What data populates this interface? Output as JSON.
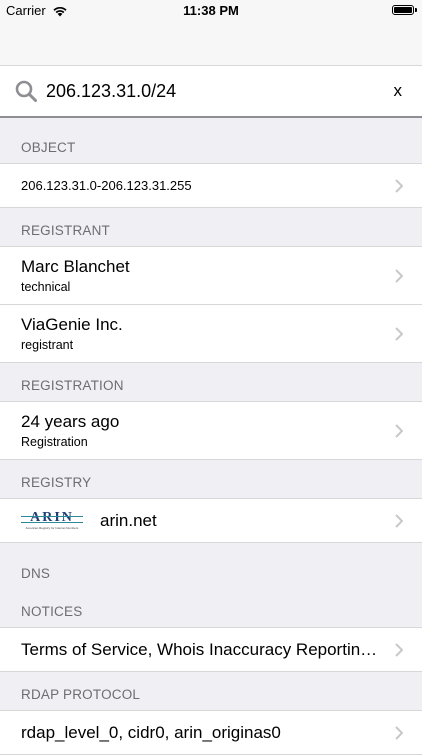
{
  "status_bar": {
    "carrier": "Carrier",
    "time": "11:38 PM"
  },
  "search": {
    "value": "206.123.31.0/24",
    "clear_label": "x"
  },
  "sections": {
    "object": {
      "header": "OBJECT",
      "rows": [
        {
          "title": "206.123.31.0-206.123.31.255"
        }
      ]
    },
    "registrant": {
      "header": "REGISTRANT",
      "rows": [
        {
          "title": "Marc Blanchet",
          "subtitle": "technical"
        },
        {
          "title": "ViaGenie Inc.",
          "subtitle": "registrant"
        }
      ]
    },
    "registration": {
      "header": "REGISTRATION",
      "rows": [
        {
          "title": "24 years ago",
          "subtitle": "Registration"
        }
      ]
    },
    "registry": {
      "header": "REGISTRY",
      "logo_text": "ARIN",
      "logo_tagline": "American Registry for Internet Numbers",
      "rows": [
        {
          "title": "arin.net"
        }
      ]
    },
    "dns": {
      "header": "DNS"
    },
    "notices": {
      "header": "NOTICES",
      "rows": [
        {
          "title": "Terms of Service, Whois Inaccuracy Reporting, Copyright Notice"
        }
      ]
    },
    "rdap_protocol": {
      "header": "RDAP PROTOCOL",
      "rows": [
        {
          "title": "rdap_level_0, cidr0, arin_originas0"
        }
      ]
    }
  },
  "icons": {
    "search": "search-icon",
    "chevron": "chevron-right-icon",
    "wifi": "wifi-icon",
    "battery": "battery-icon"
  },
  "colors": {
    "background": "#efeff4",
    "section_header_text": "#6d6d72",
    "chevron": "#c7c7cc",
    "separator": "#d8d8d8"
  }
}
